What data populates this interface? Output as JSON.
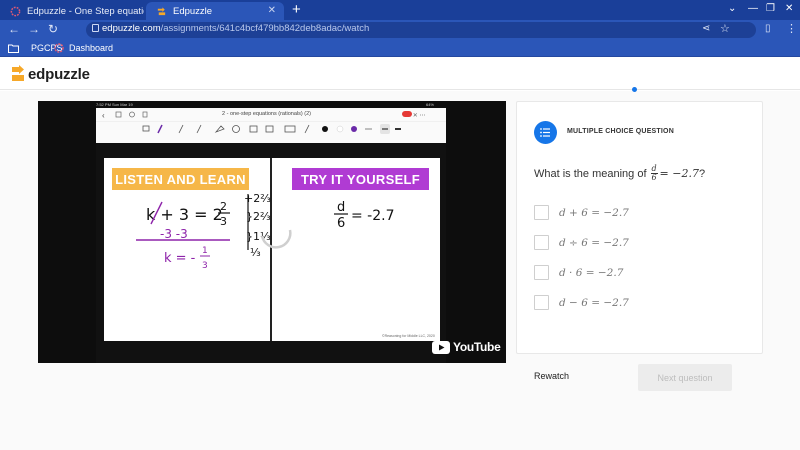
{
  "browser": {
    "tabs": [
      {
        "title": "Edpuzzle - One Step equations w",
        "active": false
      },
      {
        "title": "Edpuzzle",
        "active": true
      }
    ],
    "new_tab_glyph": "+",
    "url_domain": "edpuzzle.com",
    "url_path": "/assignments/641c4bcf479bb842deb8adac/watch",
    "bookmarks": [
      "PGCPS",
      "Dashboard"
    ],
    "window_controls": [
      "⌄",
      "—",
      "❐",
      "✕"
    ]
  },
  "app": {
    "logo_text": "edpuzzle",
    "brand_color": "#f6a829"
  },
  "video": {
    "ipad_status_time": "7:52 PM   Sun Mar 19",
    "ipad_battery": "64%",
    "doc_title": "2 - one-step equations (rationals) (2)",
    "left_heading": "LISTEN AND LEARN",
    "right_heading": "TRY IT YOURSELF",
    "copyright": "©Reasoning for Middle LLC, 2020",
    "youtube_text": "YouTube",
    "colors": {
      "left_heading": "#f6b748",
      "right_heading": "#b03bd3",
      "ink_purple": "#8e24aa"
    }
  },
  "question": {
    "type_label": "MULTIPLE CHOICE QUESTION",
    "prompt_prefix": "What is the meaning of",
    "prompt_frac_num": "d",
    "prompt_frac_den": "6",
    "prompt_suffix": "= −2.7",
    "prompt_end": "?",
    "options": [
      "d + 6 = −2.7",
      "d ÷ 6 = −2.7",
      "d · 6 = −2.7",
      "d − 6 = −2.7"
    ]
  },
  "actions": {
    "rewatch": "Rewatch",
    "next": "Next question"
  }
}
